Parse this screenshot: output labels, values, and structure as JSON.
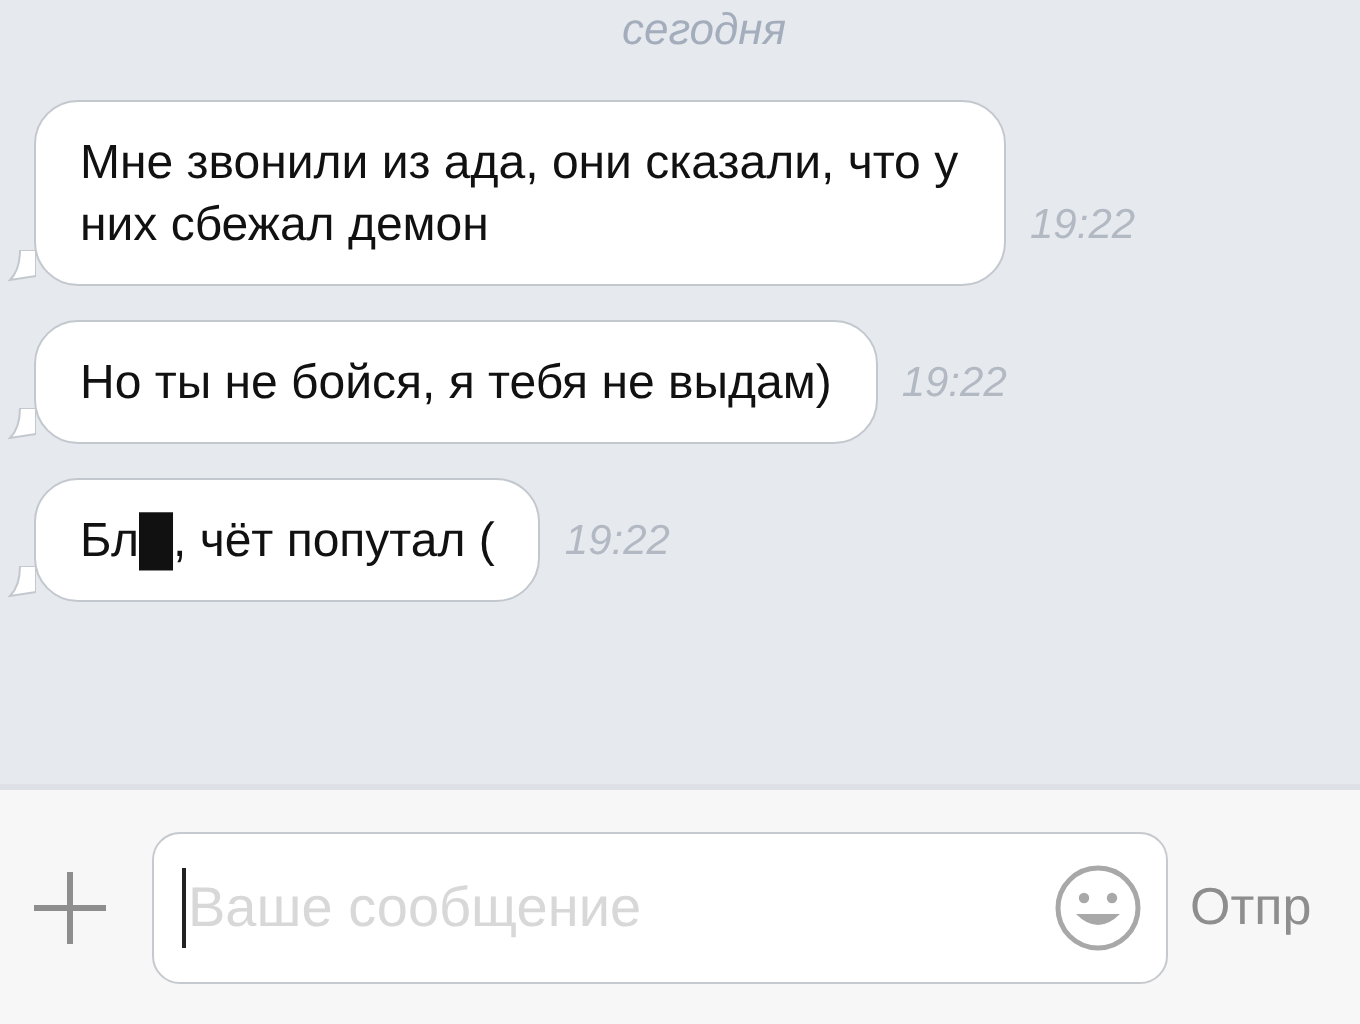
{
  "date_separator": "сегодня",
  "messages": [
    {
      "text": "Мне звонили из ада, они сказали, что у них сбежал демон",
      "time": "19:22"
    },
    {
      "text": "Но ты не бойся, я тебя не выдам)",
      "time": "19:22"
    },
    {
      "text": "Бл█, чёт попутал (",
      "time": "19:22"
    }
  ],
  "composer": {
    "placeholder": "Ваше сообщение",
    "send_label": "Отпр"
  }
}
